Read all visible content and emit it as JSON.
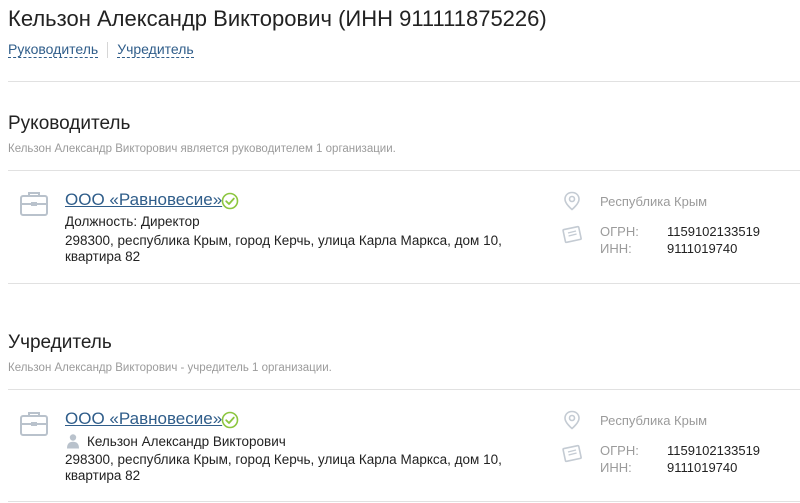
{
  "header": {
    "title": "Кельзон Александр Викторович (ИНН 911111875226)",
    "tabs": [
      "Руководитель",
      "Учредитель"
    ]
  },
  "sections": [
    {
      "title": "Руководитель",
      "subtitle": "Кельзон Александр Викторович является руководителем 1 организации.",
      "card": {
        "org_name": "ООО «Равновесие»",
        "position": "Должность: Директор",
        "address_line1": "298300, республика Крым, город Керчь, улица Карла Маркса, дом 10,",
        "address_line2": "квартира 82",
        "region": "Республика Крым",
        "ogrn_label": "ОГРН:",
        "ogrn": "1159102133519",
        "inn_label": "ИНН:",
        "inn": "9111019740"
      }
    },
    {
      "title": "Учредитель",
      "subtitle": "Кельзон Александр Викторович - учредитель 1 организации.",
      "card": {
        "org_name": "ООО «Равновесие»",
        "person": "Кельзон Александр Викторович",
        "address_line1": "298300, республика Крым, город Керчь, улица Карла Маркса, дом 10,",
        "address_line2": "квартира 82",
        "region": "Республика Крым",
        "ogrn_label": "ОГРН:",
        "ogrn": "1159102133519",
        "inn_label": "ИНН:",
        "inn": "9111019740"
      }
    }
  ],
  "colors": {
    "link": "#2f5d8a",
    "muted": "#9b9b9b",
    "divider": "#e1e1e1",
    "verified": "#8cc63f",
    "icon": "#b9c2cc"
  },
  "icons": {
    "org": "briefcase-icon",
    "verified": "check-circle-icon",
    "geo": "map-pin-icon",
    "registration": "document-icon",
    "person": "person-icon"
  }
}
